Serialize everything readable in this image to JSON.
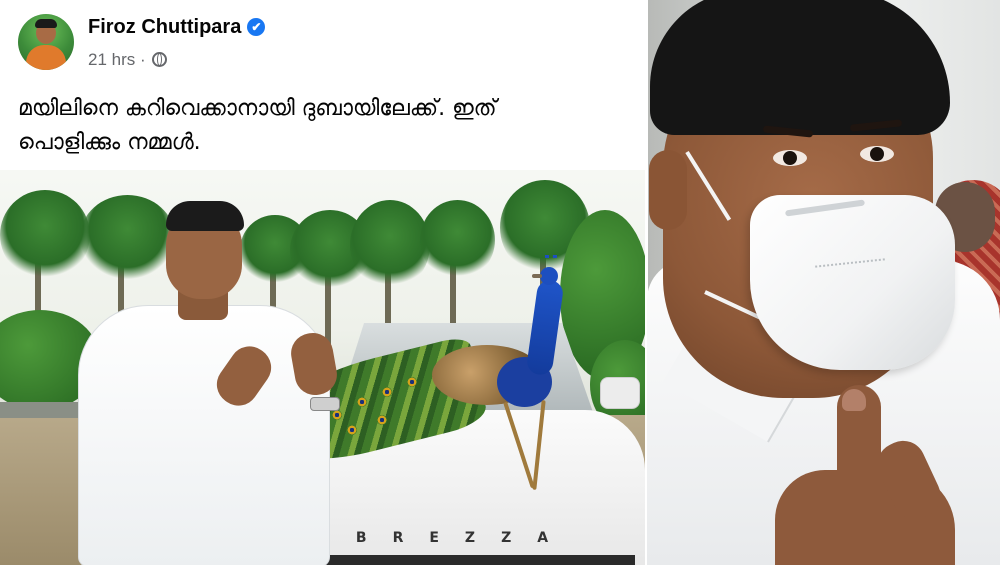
{
  "post": {
    "author": "Firoz Chuttipara",
    "timestamp": "21 hrs",
    "separator": "·",
    "verified_icon": "✔",
    "caption_lines": [
      "മയിലിനെ കറിവെക്കാനായി ദുബായിലേക്ക്. ഇത്",
      "പൊളിക്കും നമ്മൾ."
    ],
    "car_badge": "BREZZA"
  },
  "icons": {
    "verified": "verified-badge-icon",
    "audience": "globe-icon"
  },
  "colors": {
    "brand_blue": "#1877f2",
    "author_text": "#050505",
    "meta_text": "#65676b"
  }
}
